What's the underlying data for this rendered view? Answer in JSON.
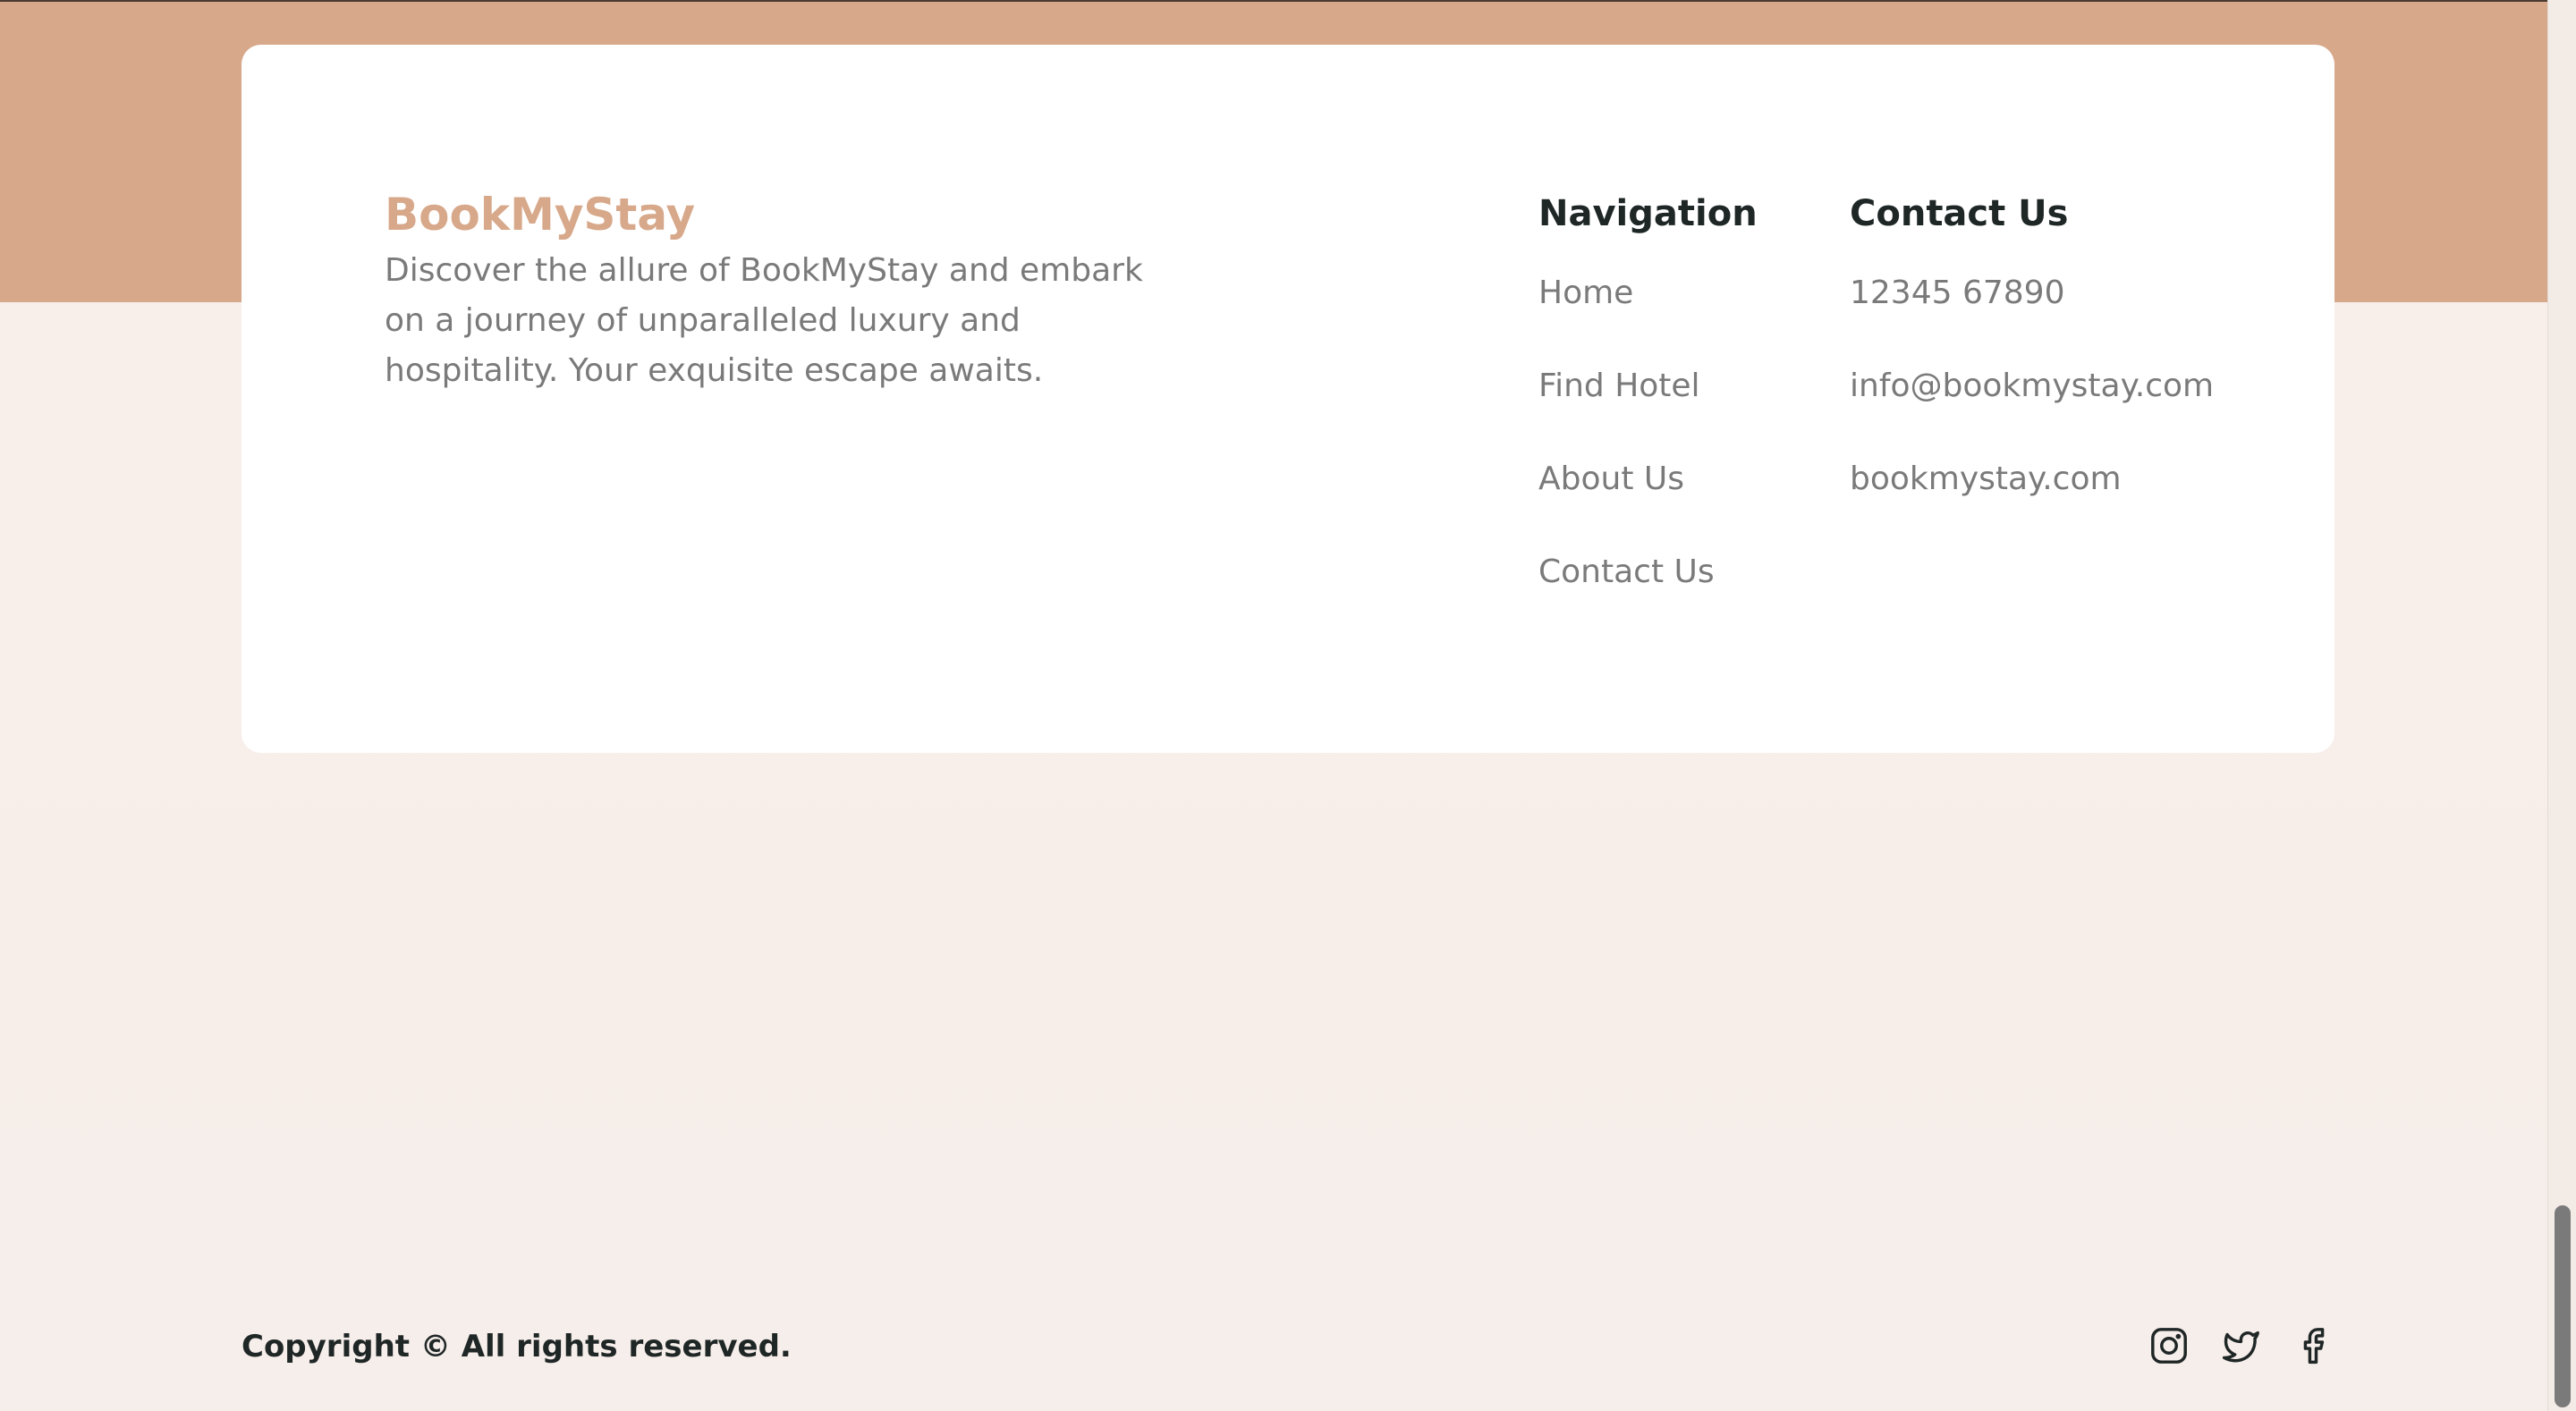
{
  "brand": {
    "name": "BookMyStay",
    "description": "Discover the allure of BookMyStay and embark on a journey of unparalleled luxury and hospitality. Your exquisite escape awaits."
  },
  "navigation": {
    "heading": "Navigation",
    "items": [
      {
        "label": "Home"
      },
      {
        "label": "Find Hotel"
      },
      {
        "label": "About Us"
      },
      {
        "label": "Contact Us"
      }
    ]
  },
  "contact": {
    "heading": "Contact Us",
    "items": [
      {
        "label": "12345 67890"
      },
      {
        "label": "info@bookmystay.com"
      },
      {
        "label": "bookmystay.com"
      }
    ]
  },
  "footer": {
    "copyright": "Copyright © All rights reserved.",
    "social": [
      {
        "icon": "instagram-icon"
      },
      {
        "icon": "twitter-icon"
      },
      {
        "icon": "facebook-icon"
      }
    ]
  },
  "colors": {
    "accent": "#d7a88a",
    "background": "#f8f0eb",
    "heading": "#1f2626",
    "muted_text": "#7a7a7a"
  }
}
